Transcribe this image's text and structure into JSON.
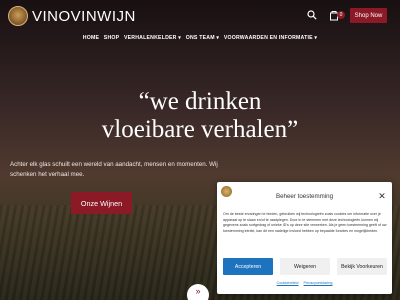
{
  "header": {
    "brand": "VINOVINWIJN",
    "cart_count": "0",
    "shop_button": "Shop Now",
    "icons": {
      "logo": "winery-seal-logo",
      "search": "search-icon",
      "cart": "cart-icon"
    }
  },
  "nav": {
    "items": [
      "HOME",
      "SHOP",
      "VERHALENKELDER ▾",
      "ONS TEAM ▾",
      "VOORWAARDEN EN INFORMATIE ▾"
    ]
  },
  "hero": {
    "headline_line1": "“we drinken",
    "headline_line2": "vloeibare verhalen”",
    "intro_line1": "Achter elk glas schuilt een wereld van aandacht, mensen en momenten. Wij",
    "intro_line2": "schenken het verhaal mee.",
    "cta": "Onze Wijnen"
  },
  "cookie": {
    "title": "Beheer toestemming",
    "text": "Om de beste ervaringen te bieden, gebruiken wij technologieën zoals cookies om informatie over je apparaat op te slaan en/of te raadplegen. Door in te stemmen met deze technologieën kunnen wij gegevens zoals surfgedrag of unieke ID's op deze site verwerken. Als je geen toestemming geeft of uw toestemming intrekt, kan dit een nadelige invloed hebben op bepaalde functies en mogelijkheden.",
    "accept": "Accepteren",
    "deny": "Weigeren",
    "preferences": "Bekijk Voorkeuren",
    "link_cookie": "Cookiebeleid",
    "link_privacy": "Privacyverklaring"
  },
  "colors": {
    "accent": "#8b1a26",
    "cookie_primary": "#1e73be"
  }
}
